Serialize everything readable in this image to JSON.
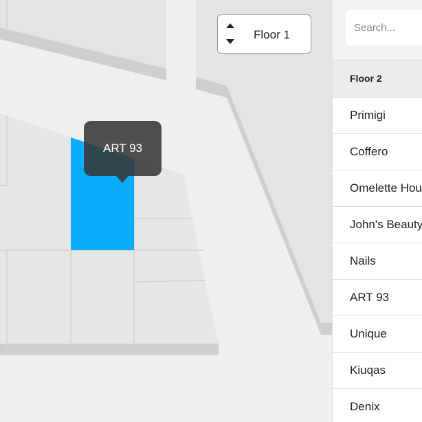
{
  "map": {
    "highlighted_store": "ART 93",
    "tooltip_text": "ART 93",
    "colors": {
      "highlight": "#0aacfb",
      "store_fill": "#e5e5e5",
      "wall": "#cfcfcf",
      "background": "#f0eff0"
    }
  },
  "floor_switcher": {
    "current_floor": "Floor 1",
    "up_icon": "arrow-up-icon",
    "down_icon": "arrow-down-icon"
  },
  "sidebar": {
    "search_placeholder": "Search...",
    "floor_header": "Floor 2",
    "stores": [
      "Primigi",
      "Coffero",
      "Omelette House",
      "John's Beauty",
      "Nails",
      "ART 93",
      "Unique",
      "Kiuqas",
      "Denix"
    ]
  }
}
